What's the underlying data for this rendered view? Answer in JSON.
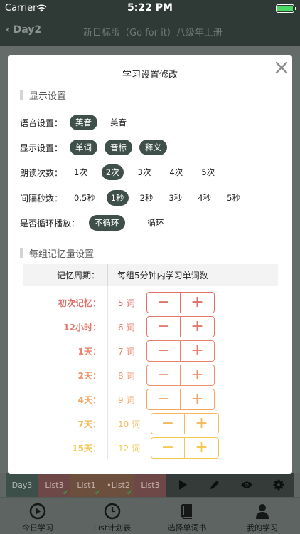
{
  "status_bar": {
    "carrier": "Carrier",
    "time": "5:22 PM"
  },
  "nav": {
    "back_label": "Day2",
    "title": "新目标版（Go for it）八级年上册"
  },
  "modal": {
    "title": "学习设置修改",
    "display_section": "显示设置",
    "voice": {
      "label": "语音设置：",
      "options": [
        "英音",
        "美音"
      ],
      "selected": "英音"
    },
    "show": {
      "label": "显示设置：",
      "options": [
        "单词",
        "音标",
        "释义"
      ],
      "selected": [
        "单词",
        "音标",
        "释义"
      ]
    },
    "reads": {
      "label": "朗读次数：",
      "options": [
        "1次",
        "2次",
        "3次",
        "4次",
        "5次"
      ],
      "selected": "2次"
    },
    "interval": {
      "label": "间隔秒数：",
      "options": [
        "0.5秒",
        "1秒",
        "2秒",
        "3秒",
        "4秒",
        "5秒"
      ],
      "selected": "1秒"
    },
    "loop": {
      "label": "是否循环播放：",
      "options": [
        "不循环",
        "循环"
      ],
      "selected": "不循环"
    },
    "memory_section": "每组记忆量设置",
    "table_header": {
      "period": "记忆周期：",
      "count": "每组5分钟内学习单词数"
    },
    "memory_rows": [
      {
        "name": "初次记忆：",
        "value": "5 词",
        "color": "#e06e68"
      },
      {
        "name": "12小时：",
        "value": "6 词",
        "color": "#e4776c"
      },
      {
        "name": "1天：",
        "value": "7 词",
        "color": "#e9846c"
      },
      {
        "name": "2天：",
        "value": "8 词",
        "color": "#ee936b"
      },
      {
        "name": "4天：",
        "value": "9 词",
        "color": "#f3a563"
      },
      {
        "name": "7天：",
        "value": "10 词",
        "color": "#f5b85c"
      },
      {
        "name": "15天：",
        "value": "12 词",
        "color": "#f6c64f"
      }
    ],
    "minus": "−",
    "plus": "+"
  },
  "list_bar": {
    "day": "Day3",
    "lists": [
      {
        "label": "List3",
        "done": true
      },
      {
        "label": "List1",
        "done": true
      },
      {
        "label": "•List2",
        "done": true
      },
      {
        "label": "List3",
        "done": false
      }
    ],
    "checkmark": "✔"
  },
  "tab_bar": {
    "tabs": [
      "今日学习",
      "List计划表",
      "选择单词书",
      "我的学习"
    ]
  }
}
